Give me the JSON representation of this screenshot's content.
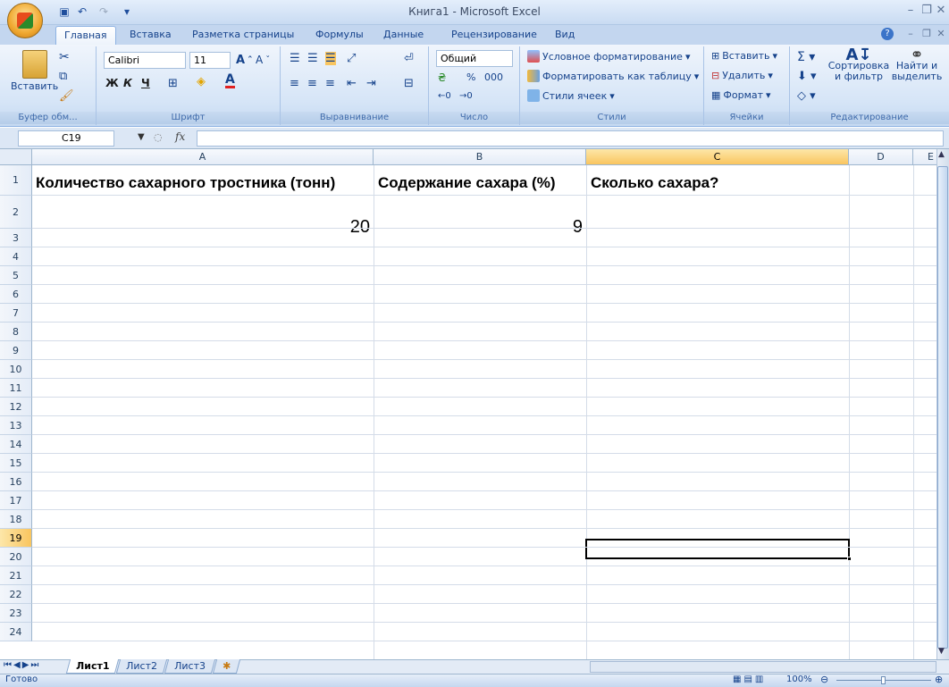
{
  "window": {
    "title": "Книга1 - Microsoft Excel"
  },
  "tabs": [
    "Главная",
    "Вставка",
    "Разметка страницы",
    "Формулы",
    "Данные",
    "Рецензирование",
    "Вид"
  ],
  "ribbon": {
    "clipboard": {
      "paste": "Вставить",
      "label": "Буфер обм..."
    },
    "font": {
      "name": "Calibri",
      "size": "11",
      "bold": "Ж",
      "italic": "К",
      "underline": "Ч",
      "label": "Шрифт"
    },
    "alignment": {
      "label": "Выравнивание"
    },
    "number": {
      "format": "Общий",
      "percent": "%",
      "thousands": "000",
      "label": "Число"
    },
    "styles": {
      "conditional": "Условное форматирование",
      "format_table": "Форматировать как таблицу",
      "cell_styles": "Стили ячеек",
      "label": "Стили"
    },
    "cells": {
      "insert": "Вставить",
      "delete": "Удалить",
      "format": "Формат",
      "label": "Ячейки"
    },
    "editing": {
      "sort": "Сортировка и фильтр",
      "find": "Найти и выделить",
      "label": "Редактирование"
    }
  },
  "formula_bar": {
    "name_box": "C19",
    "fx": "fx",
    "value": ""
  },
  "grid": {
    "columns": [
      "A",
      "B",
      "C",
      "D",
      "E"
    ],
    "rows": [
      "1",
      "2",
      "3",
      "4",
      "5",
      "6",
      "7",
      "8",
      "9",
      "10",
      "11",
      "12",
      "13",
      "14",
      "15",
      "16",
      "17",
      "18",
      "19",
      "20",
      "21",
      "22",
      "23",
      "24"
    ],
    "cells": {
      "A1": "Количество сахарного тростника (тонн)",
      "B1": "Содержание сахара (%)",
      "C1": "Сколько сахара?",
      "A2": "20",
      "B2": "9"
    },
    "active_cell": "C19"
  },
  "sheets": [
    "Лист1",
    "Лист2",
    "Лист3"
  ],
  "status": {
    "text": "Готово",
    "zoom": "100%"
  }
}
